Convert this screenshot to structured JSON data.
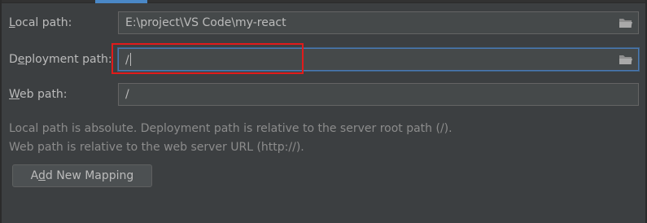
{
  "mapping": {
    "local_path": {
      "label_mnemonic": "L",
      "label_rest": "ocal path:",
      "value": "E:\\project\\VS Code\\my-react"
    },
    "deployment_path": {
      "label_pre": "D",
      "label_mnemonic": "e",
      "label_rest": "ployment path:",
      "value": "/"
    },
    "web_path": {
      "label_mnemonic": "W",
      "label_rest": "eb path:",
      "value": "/"
    }
  },
  "help": {
    "line1": "Local path is absolute. Deployment path is relative to the server root path (/).",
    "line2": "Web path is relative to the web server URL (http://)."
  },
  "add_button": {
    "label_pre": "A",
    "label_mnemonic": "d",
    "label_rest": "d New Mapping"
  },
  "icons": {
    "browse": "folder-icon"
  },
  "colors": {
    "background": "#3c3f41",
    "field": "#45494a",
    "focus_border": "#4b79b3",
    "highlight": "#e11b1b",
    "accent_tab": "#4a88c7"
  }
}
